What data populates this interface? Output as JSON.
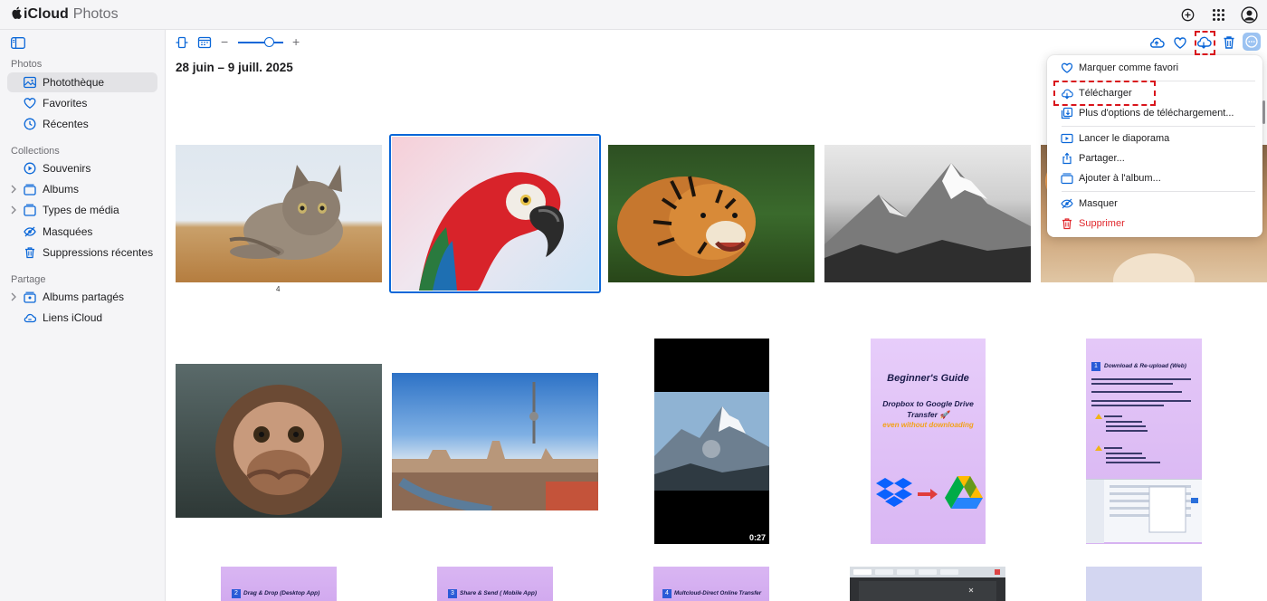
{
  "app": {
    "apple_glyph": "",
    "brand_bold": "iCloud",
    "brand_light": "Photos"
  },
  "sidebar": {
    "sections": {
      "photos": "Photos",
      "collections": "Collections",
      "sharing": "Partage"
    },
    "items": [
      {
        "label": "Photothèque",
        "icon": "photo-library-icon"
      },
      {
        "label": "Favorites",
        "icon": "heart-icon"
      },
      {
        "label": "Récentes",
        "icon": "clock-icon"
      },
      {
        "label": "Souvenirs",
        "icon": "memories-icon"
      },
      {
        "label": "Albums",
        "icon": "album-stack-icon"
      },
      {
        "label": "Types de média",
        "icon": "media-types-icon"
      },
      {
        "label": "Masquées",
        "icon": "eye-slash-icon"
      },
      {
        "label": "Suppressions récentes",
        "icon": "trash-icon"
      },
      {
        "label": "Albums partagés",
        "icon": "shared-album-icon"
      },
      {
        "label": "Liens iCloud",
        "icon": "cloud-link-icon"
      }
    ]
  },
  "toolbar": {
    "zoom_minus": "−",
    "zoom_plus": "+",
    "zoom_level": 0.6
  },
  "main": {
    "date_range": "28 juin – 9 juill. 2025",
    "photo_count_label": "4",
    "video_duration": "0:27",
    "guide1": {
      "title": "Beginner's Guide",
      "line1": "Dropbox to Google Drive",
      "line2": "Transfer 🚀",
      "line3": "even without downloading"
    },
    "guide2": {
      "badge": "1",
      "title": "Download & Re-upload (Web)"
    },
    "bottom": [
      {
        "badge": "2",
        "title": "Drag & Drop (Desktop App)"
      },
      {
        "badge": "3",
        "title": "Share & Send ( Mobile App)"
      },
      {
        "badge": "4",
        "title": "Multcloud-Direct Online Transfer"
      }
    ]
  },
  "menu": {
    "items": [
      {
        "label": "Marquer comme favori",
        "icon": "heart-icon"
      },
      {
        "label": "Télécharger",
        "icon": "cloud-download-icon"
      },
      {
        "label": "Plus d'options de téléchargement...",
        "icon": "download-options-icon"
      },
      {
        "label": "Lancer le diaporama",
        "icon": "slideshow-icon"
      },
      {
        "label": "Partager...",
        "icon": "share-icon"
      },
      {
        "label": "Ajouter à l'album...",
        "icon": "add-to-album-icon"
      },
      {
        "label": "Masquer",
        "icon": "eye-slash-icon"
      },
      {
        "label": "Supprimer",
        "icon": "trash-icon"
      }
    ]
  },
  "colors": {
    "accent": "#0a67d8",
    "danger": "#e0262b",
    "highlight": "#d9141b"
  }
}
